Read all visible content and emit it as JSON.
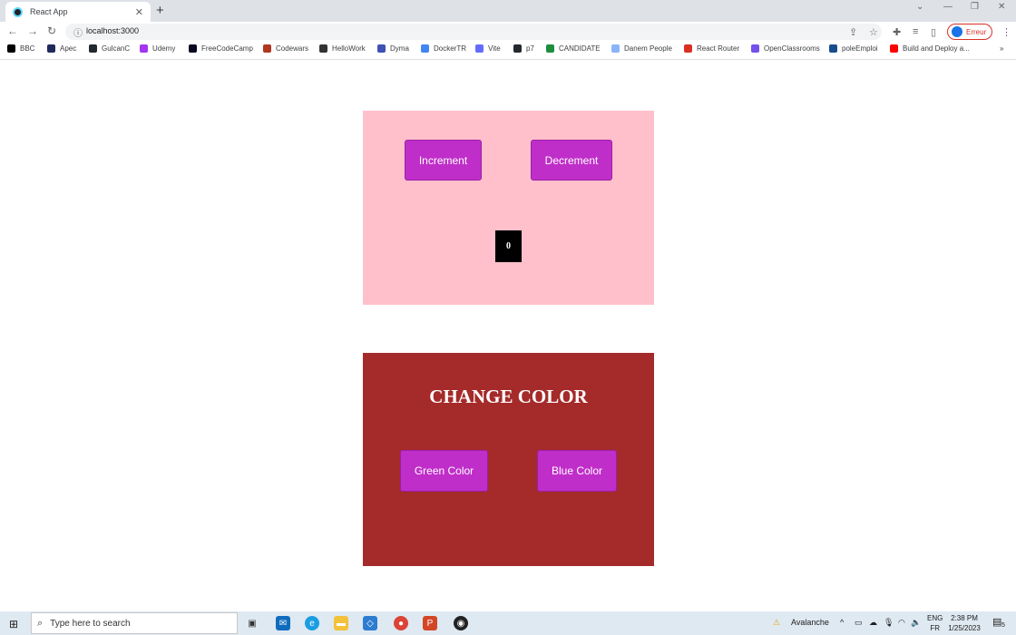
{
  "browser": {
    "tab_title": "React App",
    "url": "localhost:3000",
    "profile_label": "Erreur"
  },
  "bookmarks": [
    {
      "label": "BBC",
      "color": "#000000"
    },
    {
      "label": "Apec",
      "color": "#1e2a5a"
    },
    {
      "label": "GulcanC",
      "color": "#24292f"
    },
    {
      "label": "Udemy",
      "color": "#a435f0"
    },
    {
      "label": "FreeCodeCamp",
      "color": "#0a0a23"
    },
    {
      "label": "Codewars",
      "color": "#b1361e"
    },
    {
      "label": "HelloWork",
      "color": "#333333"
    },
    {
      "label": "Dyma",
      "color": "#3f51b5"
    },
    {
      "label": "DockerTR",
      "color": "#4285f4"
    },
    {
      "label": "Vite",
      "color": "#646cff"
    },
    {
      "label": "p7",
      "color": "#24292f"
    },
    {
      "label": "CANDIDATE",
      "color": "#1e8e3e"
    },
    {
      "label": "Danem People",
      "color": "#8ab4f8"
    },
    {
      "label": "React Router",
      "color": "#d93025"
    },
    {
      "label": "OpenClassrooms",
      "color": "#7451eb"
    },
    {
      "label": "poleEmploi",
      "color": "#1a4e8a"
    },
    {
      "label": "Build and Deploy a...",
      "color": "#ff0000"
    }
  ],
  "counter": {
    "increment_label": "Increment",
    "decrement_label": "Decrement",
    "value": "0"
  },
  "color_panel": {
    "title": "CHANGE COLOR",
    "green_label": "Green Color",
    "blue_label": "Blue Color"
  },
  "taskbar": {
    "search_placeholder": "Type here to search",
    "weather": "Avalanche",
    "lang_top": "ENG",
    "lang_bottom": "FR",
    "time": "2:38 PM",
    "date": "1/25/2023",
    "notification_count": "5"
  },
  "colors": {
    "counter_bg": "#ffc0cb",
    "color_panel_bg": "#a52a2a",
    "button_bg": "#c02ec9"
  }
}
